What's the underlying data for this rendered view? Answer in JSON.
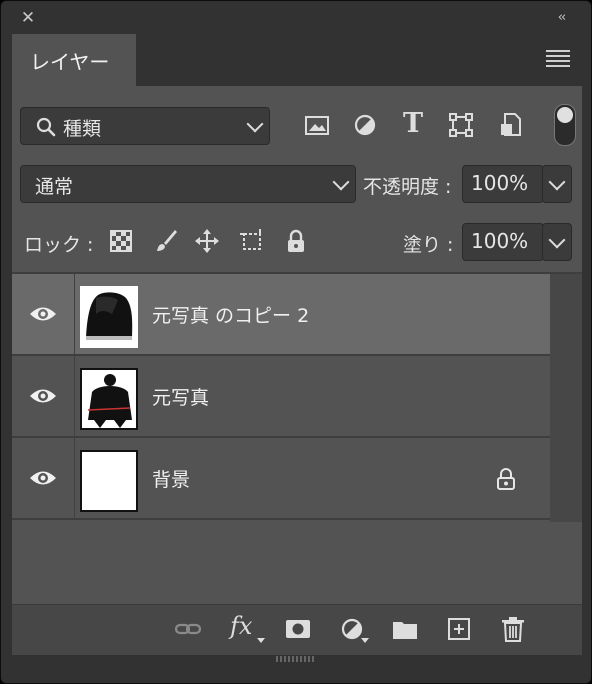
{
  "panel": {
    "close_glyph": "✕",
    "collapse_glyph": "‹‹",
    "tab_label": "レイヤー",
    "menu_icon": "hamburger-menu-icon"
  },
  "filter": {
    "kind_label": "種類",
    "icons": [
      "pixel-layer-filter-icon",
      "adjustment-layer-filter-icon",
      "type-layer-filter-icon",
      "shape-layer-filter-icon",
      "smart-object-filter-icon"
    ],
    "type_glyph": "T"
  },
  "blend": {
    "mode": "通常",
    "opacity_label": "不透明度 :",
    "opacity_value": "100%"
  },
  "lock": {
    "label": "ロック :",
    "fill_label": "塗り :",
    "fill_value": "100%"
  },
  "layers": [
    {
      "name": "元写真 のコピー 2",
      "selected": true,
      "locked": false
    },
    {
      "name": "元写真",
      "selected": false,
      "locked": false
    },
    {
      "name": "背景",
      "selected": false,
      "locked": true
    }
  ],
  "footer": {
    "fx_label": "fx",
    "icons": [
      "link-layers-icon",
      "layer-style-icon",
      "add-mask-icon",
      "new-adjustment-layer-icon",
      "new-group-icon",
      "new-layer-icon",
      "delete-layer-icon"
    ]
  },
  "colors": {
    "panel_bg": "#535353",
    "selected_row": "#6a6a6a",
    "chrome": "#323232"
  }
}
